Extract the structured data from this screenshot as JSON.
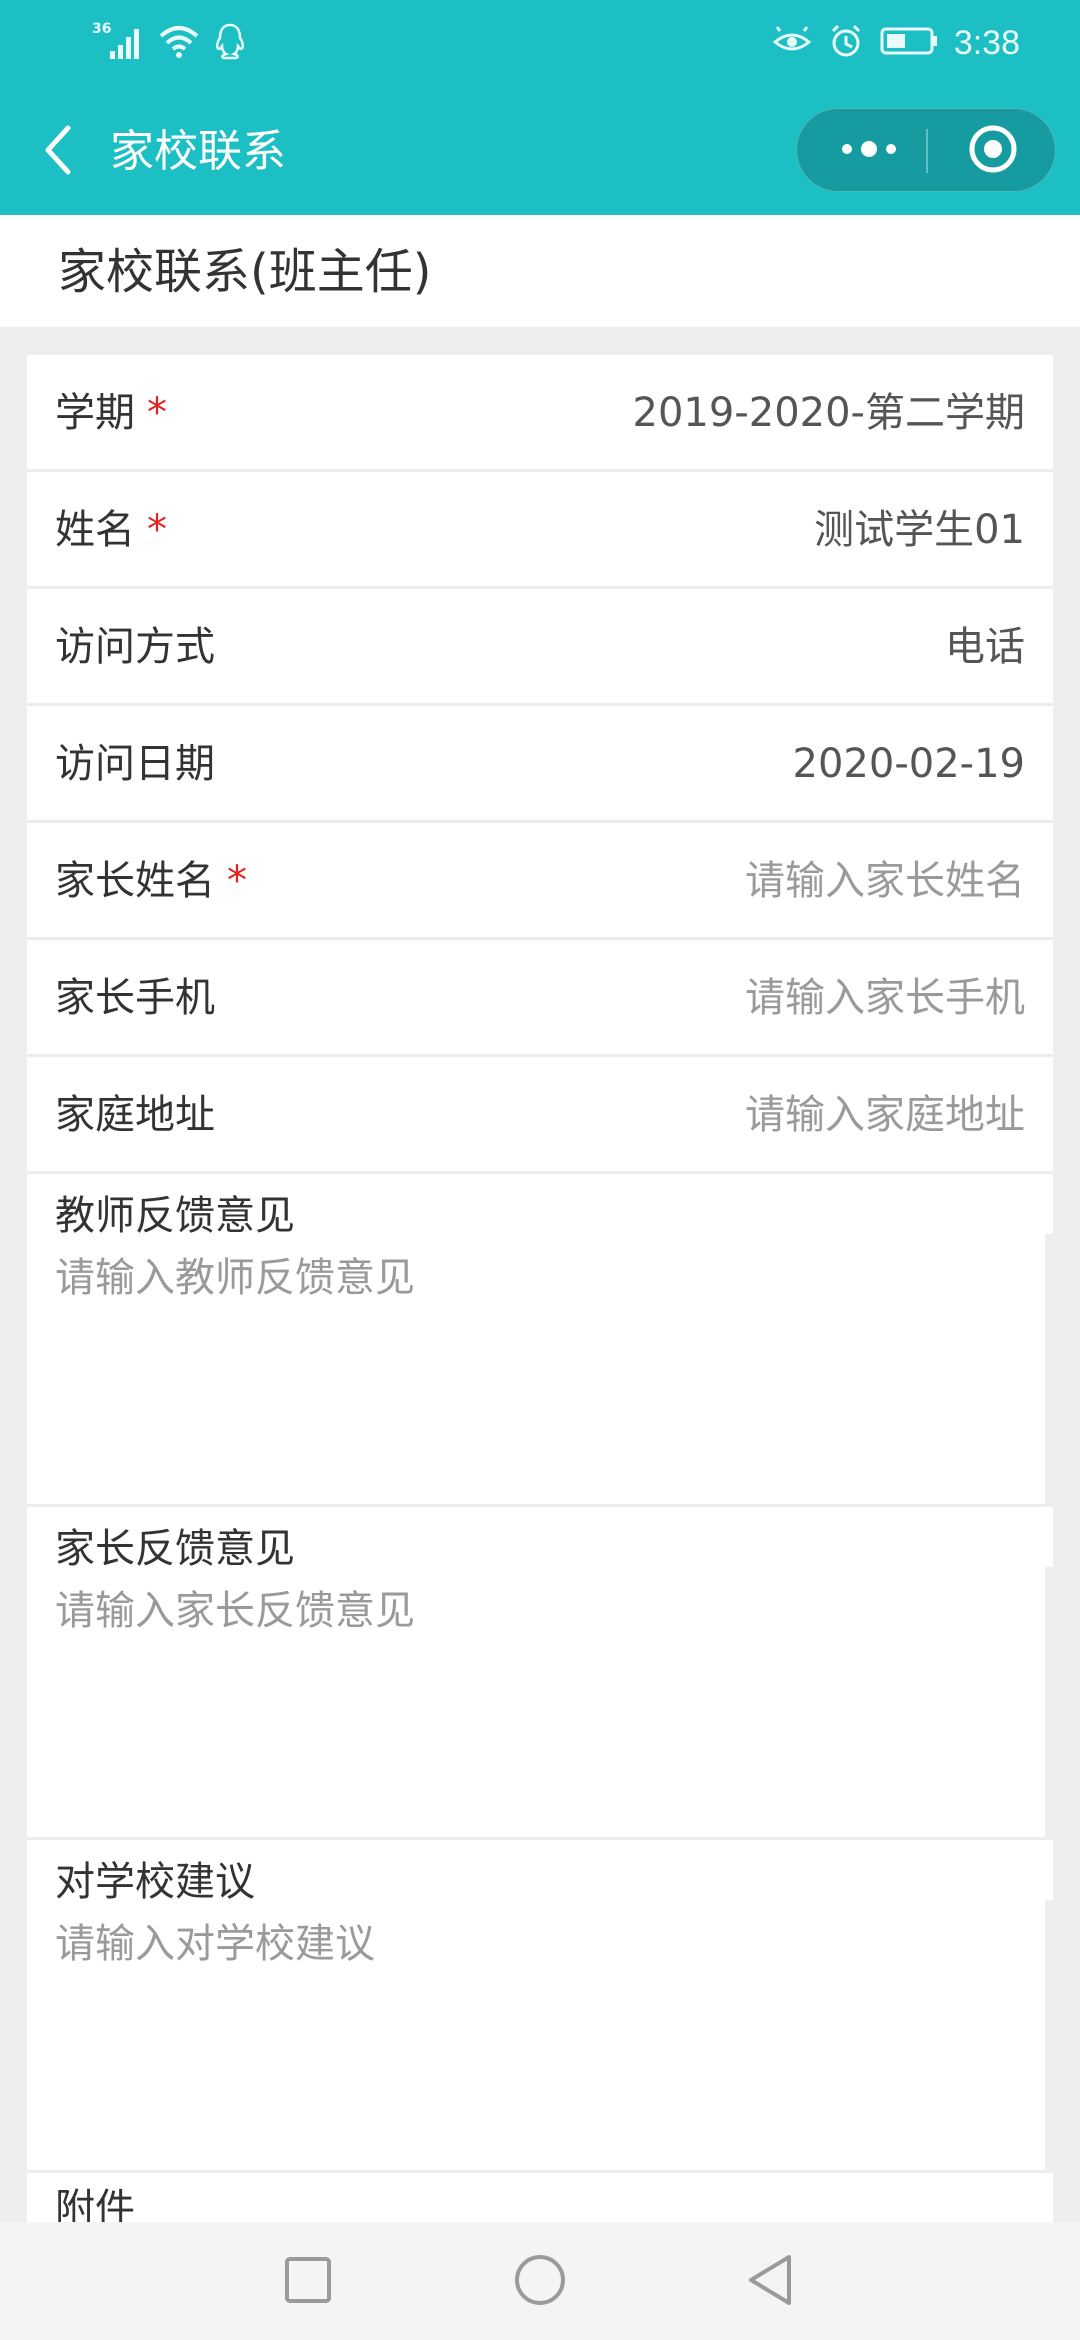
{
  "status_bar": {
    "network": "36",
    "time": "3:38",
    "icons": [
      "signal-icon",
      "wifi-icon",
      "qq-icon",
      "eye-icon",
      "alarm-icon",
      "battery-icon"
    ]
  },
  "nav": {
    "title": "家校联系",
    "more_icon": "more-dots-icon",
    "close_icon": "target-icon"
  },
  "page": {
    "title": "家校联系(班主任)"
  },
  "form": {
    "rows": [
      {
        "label": "学期",
        "required": "*",
        "value": "2019-2020-第二学期"
      },
      {
        "label": "姓名",
        "required": "*",
        "value": "测试学生01"
      },
      {
        "label": "访问方式",
        "value": "电话"
      },
      {
        "label": "访问日期",
        "value": "2020-02-19"
      },
      {
        "label": "家长姓名",
        "required": "*",
        "placeholder": "请输入家长姓名"
      },
      {
        "label": "家长手机",
        "placeholder": "请输入家长手机"
      },
      {
        "label": "家庭地址",
        "placeholder": "请输入家庭地址"
      }
    ],
    "areas": [
      {
        "label": "教师反馈意见",
        "placeholder": "请输入教师反馈意见"
      },
      {
        "label": "家长反馈意见",
        "placeholder": "请输入家长反馈意见"
      },
      {
        "label": "对学校建议",
        "placeholder": "请输入对学校建议"
      }
    ],
    "attachment_label": "附件"
  },
  "colors": {
    "brand": "#1bbfc4",
    "required": "#e02424",
    "placeholder": "#9a9a9a"
  }
}
